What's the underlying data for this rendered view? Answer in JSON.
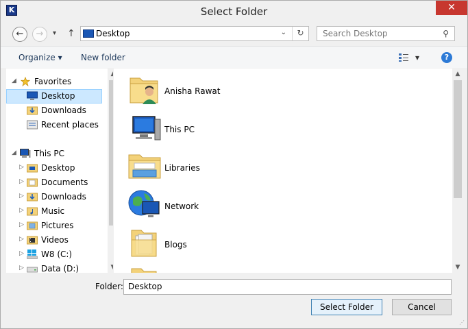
{
  "window": {
    "title": "Select Folder",
    "app_icon_letter": "K",
    "close_glyph": "✕"
  },
  "nav": {
    "back_glyph": "←",
    "forward_glyph": "→",
    "recent_glyph": "▾",
    "up_glyph": "↑",
    "address": "Desktop",
    "address_chevron": "⌄",
    "refresh_glyph": "↻",
    "search_placeholder": "Search Desktop",
    "search_glyph": "⚲"
  },
  "toolbar": {
    "organize_label": "Organize",
    "organize_arrow": "▾",
    "new_folder_label": "New folder",
    "view_arrow": "▾",
    "help_glyph": "?"
  },
  "sidebar": {
    "items": [
      {
        "label": "Favorites",
        "icon": "star-icon"
      },
      {
        "label": "Desktop",
        "icon": "desktop-icon",
        "selected": true
      },
      {
        "label": "Downloads",
        "icon": "downloads-folder-icon"
      },
      {
        "label": "Recent places",
        "icon": "recent-places-icon"
      },
      {
        "label": "This PC",
        "icon": "computer-icon"
      },
      {
        "label": "Desktop",
        "icon": "folder-icon"
      },
      {
        "label": "Documents",
        "icon": "folder-icon"
      },
      {
        "label": "Downloads",
        "icon": "folder-icon"
      },
      {
        "label": "Music",
        "icon": "music-folder-icon"
      },
      {
        "label": "Pictures",
        "icon": "pictures-folder-icon"
      },
      {
        "label": "Videos",
        "icon": "videos-folder-icon"
      },
      {
        "label": "W8 (C:)",
        "icon": "windows-drive-icon"
      },
      {
        "label": "Data (D:)",
        "icon": "drive-icon"
      }
    ],
    "expand_glyph": "▷",
    "collapse_glyph": "◢"
  },
  "content": {
    "items": [
      {
        "label": "Anisha Rawat",
        "icon": "user-folder-icon"
      },
      {
        "label": "This PC",
        "icon": "computer-icon"
      },
      {
        "label": "Libraries",
        "icon": "libraries-icon"
      },
      {
        "label": "Network",
        "icon": "network-icon"
      },
      {
        "label": "Blogs",
        "icon": "folder-icon"
      }
    ]
  },
  "scroll": {
    "up_glyph": "▲",
    "down_glyph": "▼"
  },
  "footer": {
    "folder_label": "Folder:",
    "folder_value": "Desktop",
    "select_button": "Select Folder",
    "cancel_button": "Cancel"
  },
  "colors": {
    "selection_bg": "#cce8ff",
    "close_red": "#c7372f",
    "folder_yellow": "#f3d27a",
    "monitor_blue": "#1a57b5"
  }
}
